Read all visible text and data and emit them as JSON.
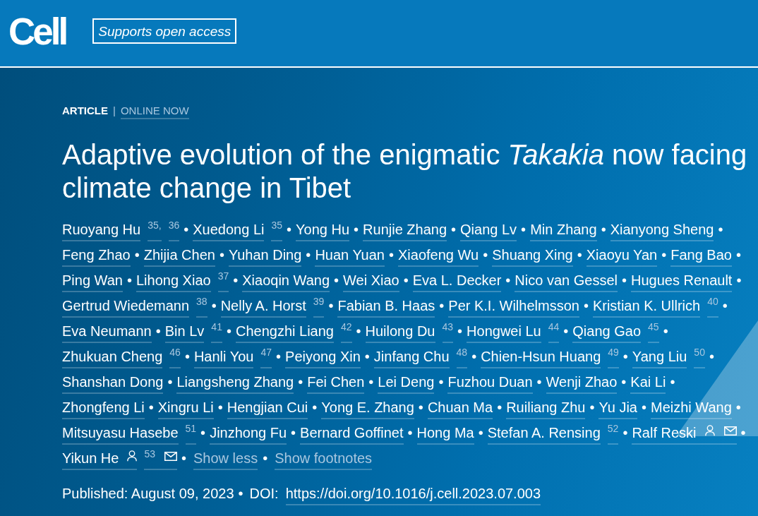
{
  "header": {
    "logo": "Cell",
    "badge": "Supports open access"
  },
  "article_label": {
    "type": "ARTICLE",
    "divider": "|",
    "status": "ONLINE NOW"
  },
  "title": "Adaptive evolution of the enigmatic *Takakia* now facing climate change in Tibet",
  "authors": [
    {
      "name": "Ruoyang Hu",
      "refs": [
        "35,",
        "36"
      ],
      "profile": false,
      "email": false,
      "separator": "•"
    },
    {
      "name": "Xuedong Li",
      "refs": [
        "35"
      ],
      "profile": false,
      "email": false,
      "separator": "•"
    },
    {
      "name": "Yong Hu",
      "profile": false,
      "email": false,
      "separator": "•"
    },
    {
      "name": "Runjie Zhang",
      "profile": false,
      "email": false,
      "separator": "•"
    },
    {
      "name": "Qiang Lv",
      "profile": false,
      "email": false,
      "separator": "•"
    },
    {
      "name": "Min Zhang",
      "profile": false,
      "email": false,
      "separator": "•"
    },
    {
      "name": "Xianyong Sheng",
      "profile": false,
      "email": false,
      "separator": "•"
    },
    {
      "name": "Feng Zhao",
      "profile": false,
      "email": false,
      "separator": "•"
    },
    {
      "name": "Zhijia Chen",
      "profile": false,
      "email": false,
      "separator": "•"
    },
    {
      "name": "Yuhan Ding",
      "profile": false,
      "email": false,
      "separator": "•"
    },
    {
      "name": "Huan Yuan",
      "profile": false,
      "email": false,
      "separator": "•"
    },
    {
      "name": "Xiaofeng Wu",
      "profile": false,
      "email": false,
      "separator": "•"
    },
    {
      "name": "Shuang Xing",
      "profile": false,
      "email": false,
      "separator": "•"
    },
    {
      "name": "Xiaoyu Yan",
      "profile": false,
      "email": false,
      "separator": "•"
    },
    {
      "name": "Fang Bao",
      "profile": false,
      "email": false,
      "separator": "•"
    },
    {
      "name": "Ping Wan",
      "profile": false,
      "email": false,
      "separator": "•"
    },
    {
      "name": "Lihong Xiao",
      "refs": [
        "37"
      ],
      "profile": false,
      "email": false,
      "separator": "•"
    },
    {
      "name": "Xiaoqin Wang",
      "profile": false,
      "email": false,
      "separator": "•"
    },
    {
      "name": "Wei Xiao",
      "profile": false,
      "email": false,
      "separator": "•"
    },
    {
      "name": "Eva L. Decker",
      "profile": false,
      "email": false,
      "separator": "•"
    },
    {
      "name": "Nico van Gessel",
      "profile": false,
      "email": false,
      "separator": "•"
    },
    {
      "name": "Hugues Renault",
      "profile": false,
      "email": false,
      "separator": "•"
    },
    {
      "name": "Gertrud Wiedemann",
      "refs": [
        "38"
      ],
      "profile": false,
      "email": false,
      "separator": "•"
    },
    {
      "name": "Nelly A. Horst",
      "refs": [
        "39"
      ],
      "profile": false,
      "email": false,
      "separator": "•"
    },
    {
      "name": "Fabian B. Haas",
      "profile": false,
      "email": false,
      "separator": "•"
    },
    {
      "name": "Per K.I. Wilhelmsson",
      "profile": false,
      "email": false,
      "separator": "•"
    },
    {
      "name": "Kristian K. Ullrich",
      "refs": [
        "40"
      ],
      "profile": false,
      "email": false,
      "separator": "•"
    },
    {
      "name": "Eva Neumann",
      "profile": false,
      "email": false,
      "separator": "•"
    },
    {
      "name": "Bin Lv",
      "refs": [
        "41"
      ],
      "profile": false,
      "email": false,
      "separator": "•"
    },
    {
      "name": "Chengzhi Liang",
      "refs": [
        "42"
      ],
      "profile": false,
      "email": false,
      "separator": "•"
    },
    {
      "name": "Huilong Du",
      "refs": [
        "43"
      ],
      "profile": false,
      "email": false,
      "separator": "•"
    },
    {
      "name": "Hongwei Lu",
      "refs": [
        "44"
      ],
      "profile": false,
      "email": false,
      "separator": "•"
    },
    {
      "name": "Qiang Gao",
      "refs": [
        "45"
      ],
      "profile": false,
      "email": false,
      "separator": "•"
    },
    {
      "name": "Zhukuan Cheng",
      "refs": [
        "46"
      ],
      "profile": false,
      "email": false,
      "separator": "•"
    },
    {
      "name": "Hanli You",
      "refs": [
        "47"
      ],
      "profile": false,
      "email": false,
      "separator": "•"
    },
    {
      "name": "Peiyong Xin",
      "profile": false,
      "email": false,
      "separator": "•"
    },
    {
      "name": "Jinfang Chu",
      "refs": [
        "48"
      ],
      "profile": false,
      "email": false,
      "separator": "•"
    },
    {
      "name": "Chien-Hsun Huang",
      "refs": [
        "49"
      ],
      "profile": false,
      "email": false,
      "separator": "•"
    },
    {
      "name": "Yang Liu",
      "refs": [
        "50"
      ],
      "profile": false,
      "email": false,
      "separator": "•"
    },
    {
      "name": "Shanshan Dong",
      "profile": false,
      "email": false,
      "separator": "•"
    },
    {
      "name": "Liangsheng Zhang",
      "profile": false,
      "email": false,
      "separator": "•"
    },
    {
      "name": "Fei Chen",
      "profile": false,
      "email": false,
      "separator": "•"
    },
    {
      "name": "Lei Deng",
      "profile": false,
      "email": false,
      "separator": "•"
    },
    {
      "name": "Fuzhou Duan",
      "profile": false,
      "email": false,
      "separator": "•"
    },
    {
      "name": "Wenji Zhao",
      "profile": false,
      "email": false,
      "separator": "•"
    },
    {
      "name": "Kai Li",
      "profile": false,
      "email": false,
      "separator": "•"
    },
    {
      "name": "Zhongfeng Li",
      "profile": false,
      "email": false,
      "separator": "•"
    },
    {
      "name": "Xingru Li",
      "profile": false,
      "email": false,
      "separator": "•"
    },
    {
      "name": "Hengjian Cui",
      "profile": false,
      "email": false,
      "separator": "•"
    },
    {
      "name": "Yong E. Zhang",
      "profile": false,
      "email": false,
      "separator": "•"
    },
    {
      "name": "Chuan Ma",
      "profile": false,
      "email": false,
      "separator": "•"
    },
    {
      "name": "Ruiliang Zhu",
      "profile": false,
      "email": false,
      "separator": "•"
    },
    {
      "name": "Yu Jia",
      "profile": false,
      "email": false,
      "separator": "•"
    },
    {
      "name": "Meizhi Wang",
      "profile": false,
      "email": false,
      "separator": "•"
    },
    {
      "name": "Mitsuyasu Hasebe",
      "refs": [
        "51"
      ],
      "profile": false,
      "email": false,
      "separator": "•"
    },
    {
      "name": "Jinzhong Fu",
      "profile": false,
      "email": false,
      "separator": "•"
    },
    {
      "name": "Bernard Goffinet",
      "profile": false,
      "email": false,
      "separator": "•"
    },
    {
      "name": "Hong Ma",
      "profile": false,
      "email": false,
      "separator": "•"
    },
    {
      "name": "Stefan A. Rensing",
      "refs": [
        "52"
      ],
      "profile": false,
      "email": false,
      "separator": "•"
    },
    {
      "name": "Ralf Reski",
      "profile": true,
      "email": true,
      "separator": "•"
    },
    {
      "name": "Yikun He",
      "refs": [
        "53"
      ],
      "profile": true,
      "email": true,
      "separator": "•"
    }
  ],
  "author_links": [
    {
      "label": "Show less",
      "separator": "•"
    },
    {
      "label": "Show footnotes"
    }
  ],
  "publication": {
    "published": "Published: August 09, 2023",
    "separator": "•",
    "doi_label": "DOI:",
    "doi": "https://doi.org/10.1016/j.cell.2023.07.003"
  }
}
